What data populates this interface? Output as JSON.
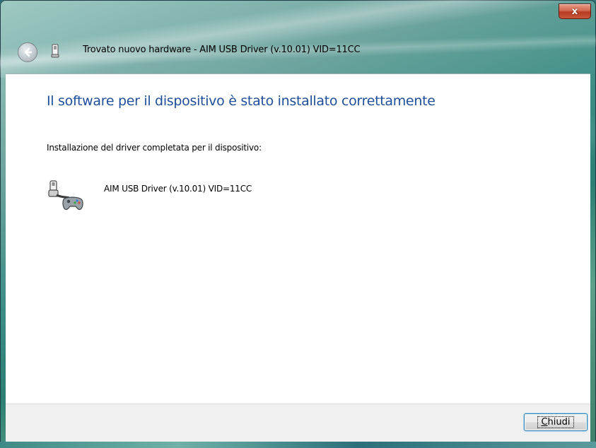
{
  "window": {
    "title": "Trovato nuovo hardware - AIM USB Driver (v.10.01) VID=11CC",
    "close_glyph": "x",
    "back_icon": "back-arrow-icon",
    "title_icon": "usb-device-icon"
  },
  "content": {
    "heading": "Il software per il dispositivo è stato installato correttamente",
    "subtext": "Installazione del driver completata per il dispositivo:",
    "device": {
      "icon": "usb-gamepad-device-icon",
      "name": "AIM USB Driver (v.10.01) VID=11CC"
    }
  },
  "footer": {
    "close_button": {
      "mnemonic": "C",
      "rest": "hiudi"
    }
  },
  "colors": {
    "heading": "#1f4e9a",
    "footer_bg": "#f0f0f0",
    "close_button_border": "#3c7fb1"
  }
}
